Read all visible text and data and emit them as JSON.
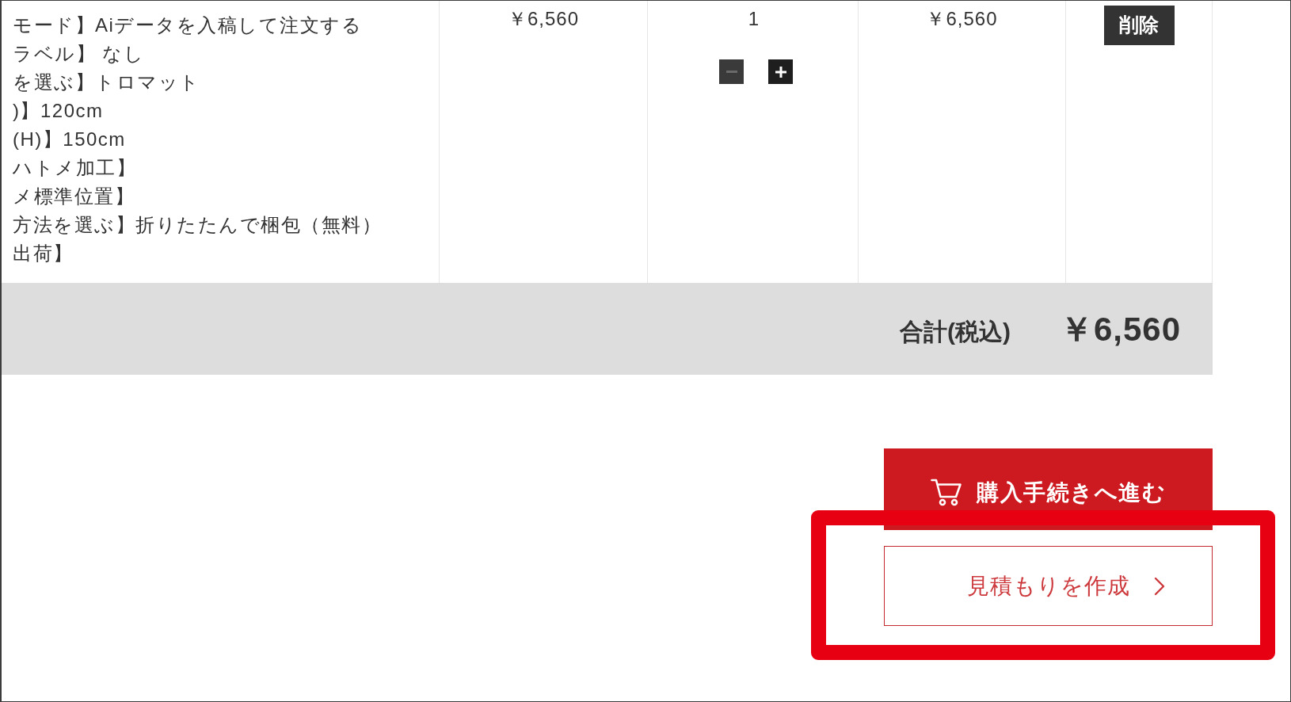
{
  "cart_item": {
    "options": [
      "モード】Aiデータを入稿して注文する",
      "ラベル】 なし",
      "を選ぶ】トロマット",
      ")】120cm",
      "(H)】150cm",
      "ハトメ加工】",
      "メ標準位置】",
      "方法を選ぶ】折りたたんで梱包（無料）",
      "出荷】"
    ],
    "unit_price": "￥6,560",
    "quantity": "1",
    "quantity_buttons": [
      {
        "kind": "decrease",
        "disabled": true
      },
      {
        "kind": "increase",
        "disabled": false
      }
    ],
    "subtotal": "￥6,560",
    "delete_button": "削除"
  },
  "total": {
    "label": "合計(税込)",
    "amount": "￥6,560"
  },
  "buttons": [
    {
      "kind": "filled",
      "label": "購入手続きへ進む",
      "highlighted": false
    },
    {
      "kind": "outline",
      "label": "見積もりを作成",
      "highlighted": true
    }
  ]
}
